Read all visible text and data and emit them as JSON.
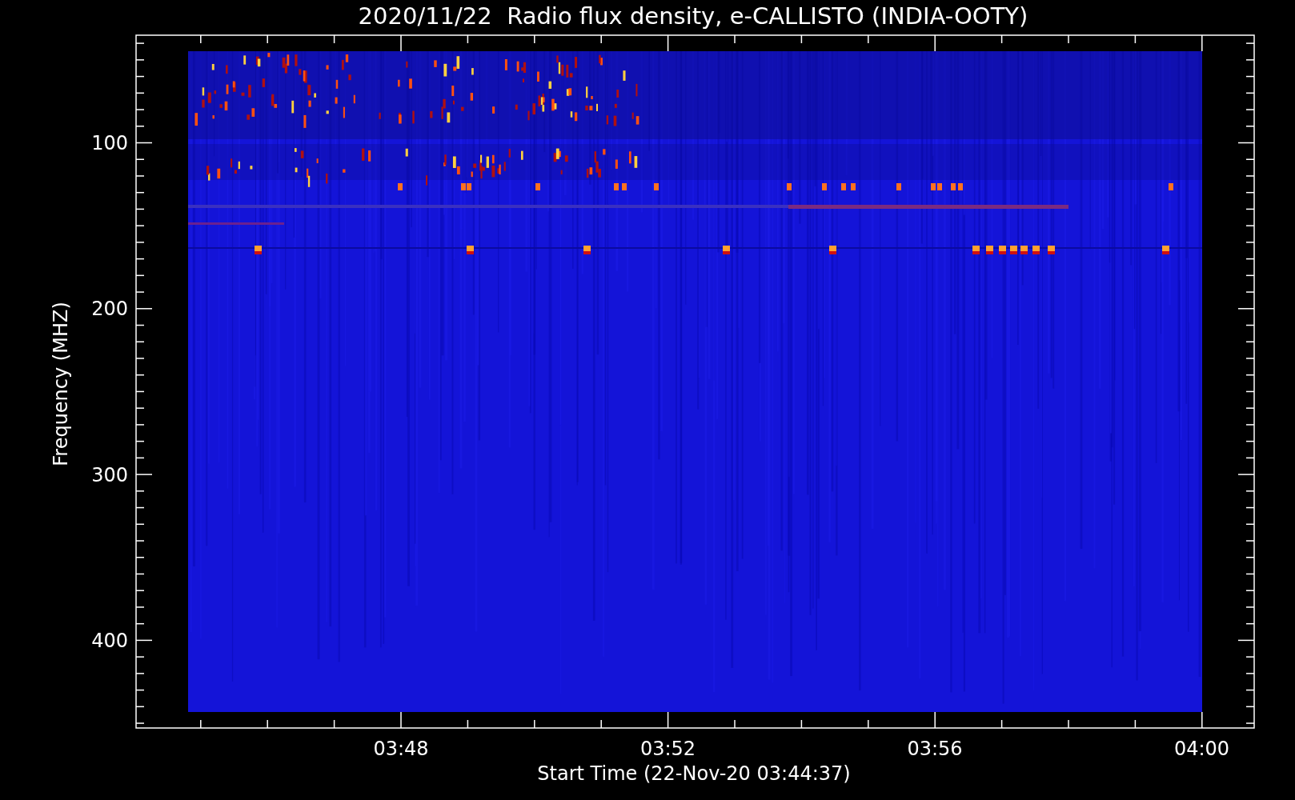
{
  "title": "2020/11/22  Radio flux density, e-CALLISTO (INDIA-OOTY)",
  "y_axis": {
    "label": "Frequency (MHZ)",
    "ticks": [
      "100",
      "200",
      "300",
      "400"
    ]
  },
  "x_axis": {
    "label": "Start Time (22-Nov-20 03:44:37)",
    "ticks": [
      "03:48",
      "03:52",
      "03:56",
      "04:00"
    ]
  }
}
